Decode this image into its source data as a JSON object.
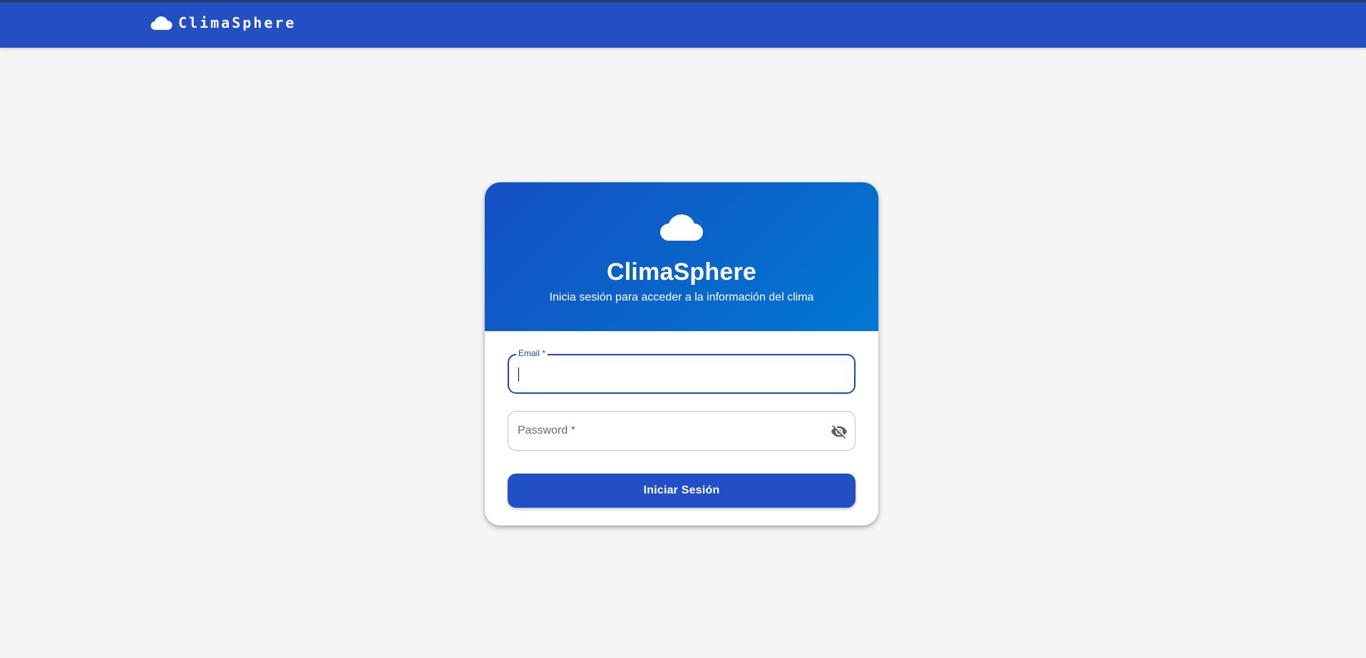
{
  "appbar": {
    "brand_name": "ClimaSphere",
    "brand_icon": "cloud-icon",
    "background_color": "#234fc4"
  },
  "login_card": {
    "header_icon": "cloud-icon",
    "title": "ClimaSphere",
    "subtitle": "Inicia sesión para acceder a la información del clima",
    "header_gradient": [
      "#1550c4",
      "#0078d4"
    ]
  },
  "form": {
    "email": {
      "label": "Email *",
      "value": "",
      "focused": true
    },
    "password": {
      "placeholder": "Password *",
      "value": "",
      "toggle_icon": "visibility-off-icon"
    },
    "submit_label": "Iniciar Sesión",
    "accent_color": "#1f47b8"
  }
}
